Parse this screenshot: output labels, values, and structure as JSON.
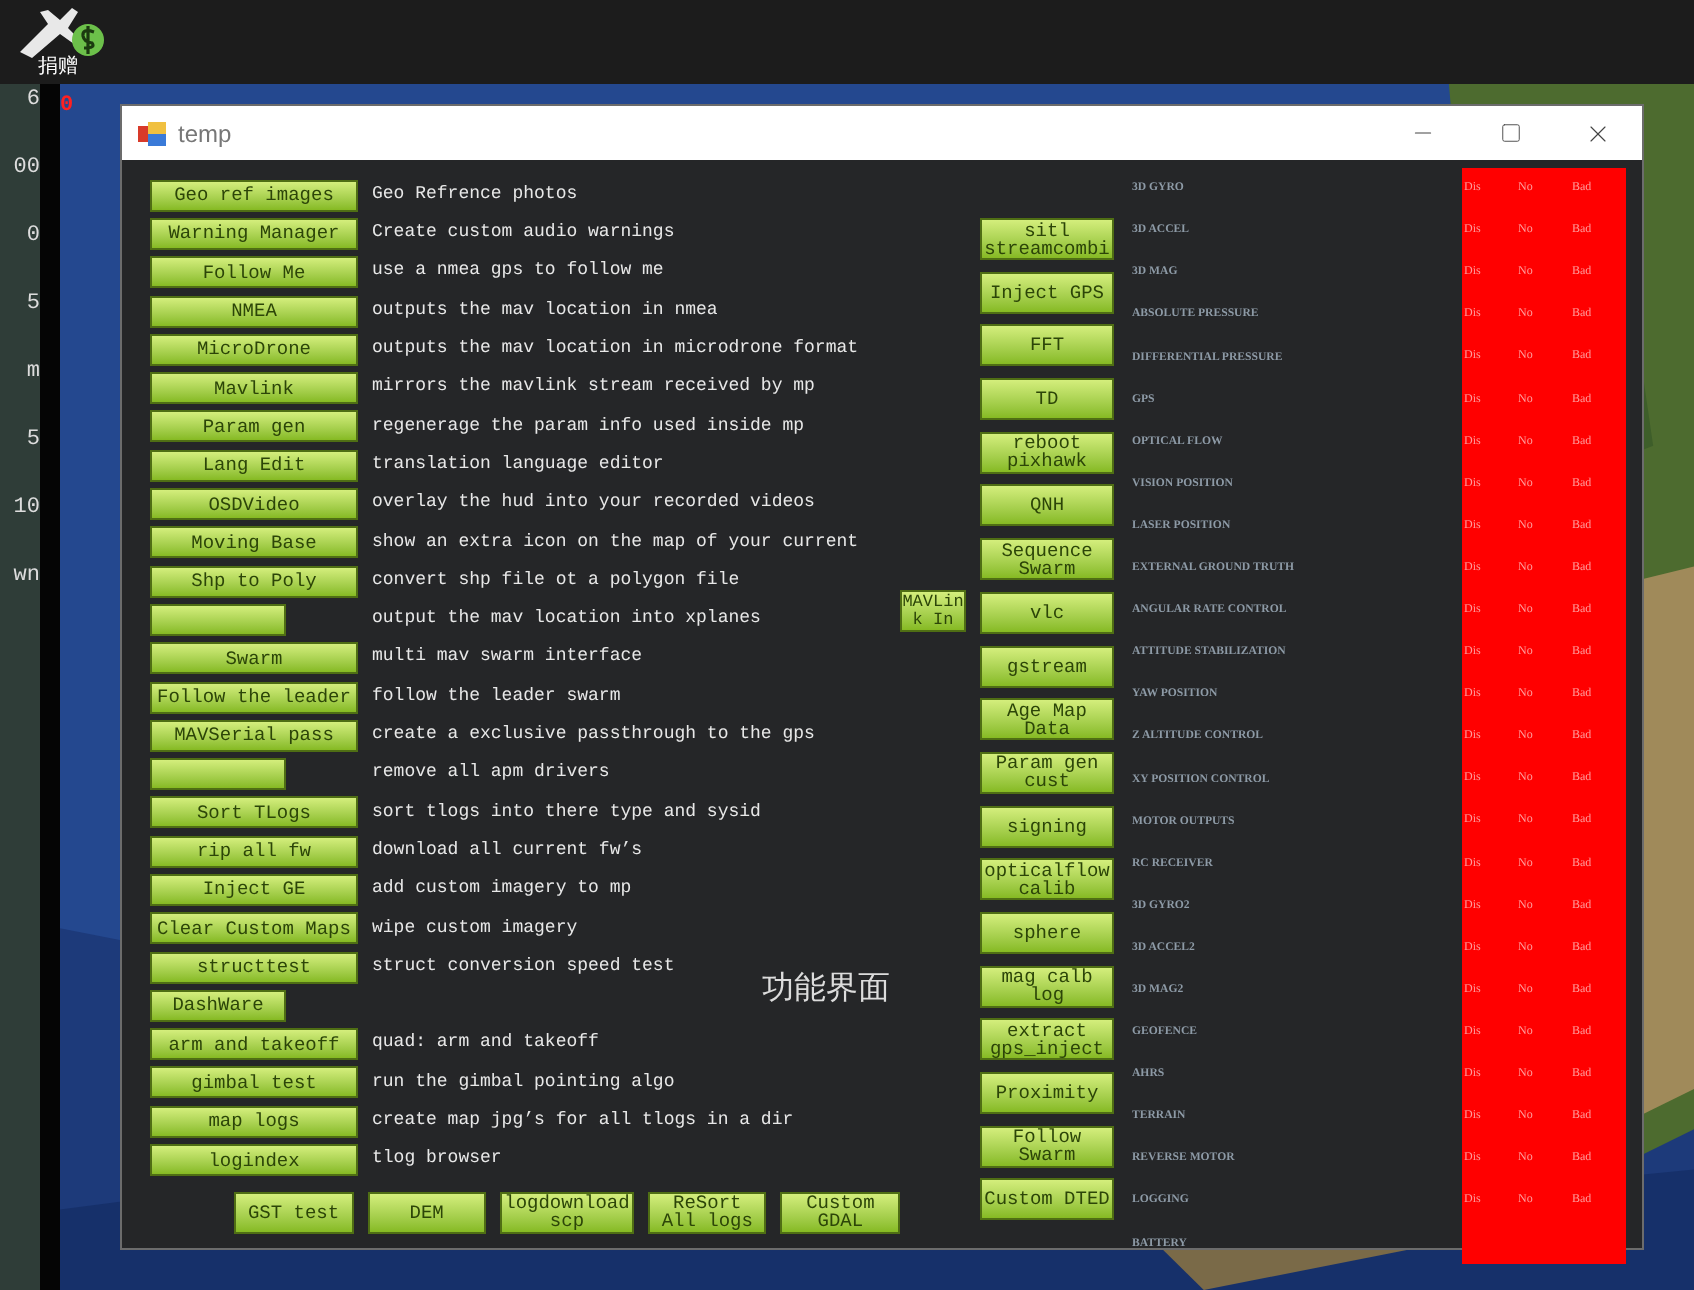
{
  "background": {
    "donate_label": "捐赠",
    "readings": [
      "6",
      "00",
      "0",
      "5",
      "m",
      "5",
      "10",
      "wn"
    ],
    "hud_value": "0"
  },
  "window": {
    "title": "temp"
  },
  "tools": [
    {
      "kind": "button",
      "label": "Geo ref images",
      "description": "Geo Refrence photos"
    },
    {
      "kind": "button",
      "label": "Warning Manager",
      "description": "Create custom audio warnings"
    },
    {
      "kind": "button",
      "label": "Follow Me",
      "description": "use a nmea gps to follow me"
    },
    {
      "kind": "button",
      "label": "NMEA",
      "description": "outputs the mav location in nmea"
    },
    {
      "kind": "button",
      "label": "MicroDrone",
      "description": "outputs the mav location in microdrone format"
    },
    {
      "kind": "button",
      "label": "Mavlink",
      "description": "mirrors the mavlink stream received by mp"
    },
    {
      "kind": "button",
      "label": "Param gen",
      "description": "regenerage the param info used inside mp"
    },
    {
      "kind": "button",
      "label": "Lang Edit",
      "description": "translation language editor"
    },
    {
      "kind": "button",
      "label": "OSDVideo",
      "description": "overlay the hud into your recorded videos"
    },
    {
      "kind": "button",
      "label": "Moving Base",
      "description": "show an extra icon on the map of your current"
    },
    {
      "kind": "button",
      "label": "Shp to Poly",
      "description": "convert shp file ot a polygon file"
    },
    {
      "kind": "short_button",
      "description": "output the mav location into xplanes"
    },
    {
      "kind": "button",
      "label": "Swarm",
      "description": "multi mav swarm interface"
    },
    {
      "kind": "button",
      "label": "Follow the leader",
      "description": "follow the leader swarm"
    },
    {
      "kind": "button",
      "label": "MAVSerial pass",
      "description": "create a exclusive passthrough to the gps"
    },
    {
      "kind": "short_button",
      "description": "remove all apm drivers"
    },
    {
      "kind": "button",
      "label": "Sort TLogs",
      "description": "sort tlogs into there type and sysid"
    },
    {
      "kind": "button",
      "label": "rip all fw",
      "description": "download all current fw’s"
    },
    {
      "kind": "button",
      "label": "Inject GE",
      "description": "add custom imagery to mp"
    },
    {
      "kind": "button",
      "label": "Clear Custom Maps",
      "description": "wipe custom imagery"
    },
    {
      "kind": "button",
      "label": "structtest",
      "description": "struct conversion speed test"
    },
    {
      "kind": "short_button",
      "label": "DashWare"
    },
    {
      "kind": "button",
      "label": "arm and takeoff",
      "description": "quad: arm and takeoff"
    },
    {
      "kind": "button",
      "label": "gimbal test",
      "description": "run the gimbal pointing algo"
    },
    {
      "kind": "button",
      "label": "map logs",
      "description": "create map jpg’s for all tlogs in a dir"
    },
    {
      "kind": "button",
      "label": "logindex",
      "description": "tlog browser"
    }
  ],
  "bottom_buttons": [
    "GST test",
    "DEM",
    "logdownload scp",
    "ReSort All logs",
    "Custom GDAL"
  ],
  "mavlink_in_button": "MAVLink In",
  "caption": "功能界面",
  "side_buttons": [
    "sitl streamcombi",
    "Inject GPS",
    "FFT",
    "TD",
    "reboot pixhawk",
    "QNH",
    "Sequence Swarm",
    "vlc",
    "gstream",
    "Age Map Data",
    "Param gen cust",
    "signing",
    "opticalflow calib",
    "sphere",
    "mag calb log",
    "extract gps_inject",
    "Proximity",
    "Follow Swarm",
    "Custom DTED"
  ],
  "sensors": [
    {
      "label": "3D GYRO",
      "enabled": "Dis",
      "present": "No",
      "health": "Bad",
      "healthy": false
    },
    {
      "label": "3D ACCEL",
      "enabled": "Dis",
      "present": "No",
      "health": "Bad",
      "healthy": false
    },
    {
      "label": "3D MAG",
      "enabled": "Dis",
      "present": "No",
      "health": "Bad",
      "healthy": false
    },
    {
      "label": "ABSOLUTE PRESSURE",
      "enabled": "Dis",
      "present": "No",
      "health": "Bad",
      "healthy": false
    },
    {
      "label": "DIFFERENTIAL PRESSURE",
      "enabled": "Dis",
      "present": "No",
      "health": "Bad",
      "healthy": false
    },
    {
      "label": "GPS",
      "enabled": "Dis",
      "present": "No",
      "health": "Bad",
      "healthy": false
    },
    {
      "label": "OPTICAL FLOW",
      "enabled": "Dis",
      "present": "No",
      "health": "Bad",
      "healthy": false
    },
    {
      "label": "VISION POSITION",
      "enabled": "Dis",
      "present": "No",
      "health": "Bad",
      "healthy": false
    },
    {
      "label": "LASER POSITION",
      "enabled": "Dis",
      "present": "No",
      "health": "Bad",
      "healthy": false
    },
    {
      "label": "EXTERNAL GROUND TRUTH",
      "enabled": "Dis",
      "present": "No",
      "health": "Bad",
      "healthy": false
    },
    {
      "label": "ANGULAR RATE CONTROL",
      "enabled": "Dis",
      "present": "No",
      "health": "Bad",
      "healthy": false
    },
    {
      "label": "ATTITUDE STABILIZATION",
      "enabled": "Dis",
      "present": "No",
      "health": "Bad",
      "healthy": false
    },
    {
      "label": "YAW POSITION",
      "enabled": "Dis",
      "present": "No",
      "health": "Bad",
      "healthy": false
    },
    {
      "label": "Z ALTITUDE CONTROL",
      "enabled": "Dis",
      "present": "No",
      "health": "Bad",
      "healthy": false
    },
    {
      "label": "XY POSITION CONTROL",
      "enabled": "Dis",
      "present": "No",
      "health": "Bad",
      "healthy": false
    },
    {
      "label": "MOTOR OUTPUTS",
      "enabled": "Dis",
      "present": "No",
      "health": "Bad",
      "healthy": false
    },
    {
      "label": "RC RECEIVER",
      "enabled": "Dis",
      "present": "No",
      "health": "Bad",
      "healthy": false
    },
    {
      "label": "3D GYRO2",
      "enabled": "Dis",
      "present": "No",
      "health": "Bad",
      "healthy": false
    },
    {
      "label": "3D ACCEL2",
      "enabled": "Dis",
      "present": "No",
      "health": "Bad",
      "healthy": false
    },
    {
      "label": "3D MAG2",
      "enabled": "Dis",
      "present": "No",
      "health": "Bad",
      "healthy": false
    },
    {
      "label": "GEOFENCE",
      "enabled": "Dis",
      "present": "No",
      "health": "Bad",
      "healthy": false
    },
    {
      "label": "AHRS",
      "enabled": "Dis",
      "present": "No",
      "health": "Bad",
      "healthy": false
    },
    {
      "label": "TERRAIN",
      "enabled": "Dis",
      "present": "No",
      "health": "Bad",
      "healthy": false
    },
    {
      "label": "REVERSE MOTOR",
      "enabled": "Dis",
      "present": "No",
      "health": "Bad",
      "healthy": false
    },
    {
      "label": "LOGGING",
      "enabled": "Dis",
      "present": "No",
      "health": "Bad",
      "healthy": false
    },
    {
      "label": "BATTERY",
      "healthy": false
    }
  ]
}
